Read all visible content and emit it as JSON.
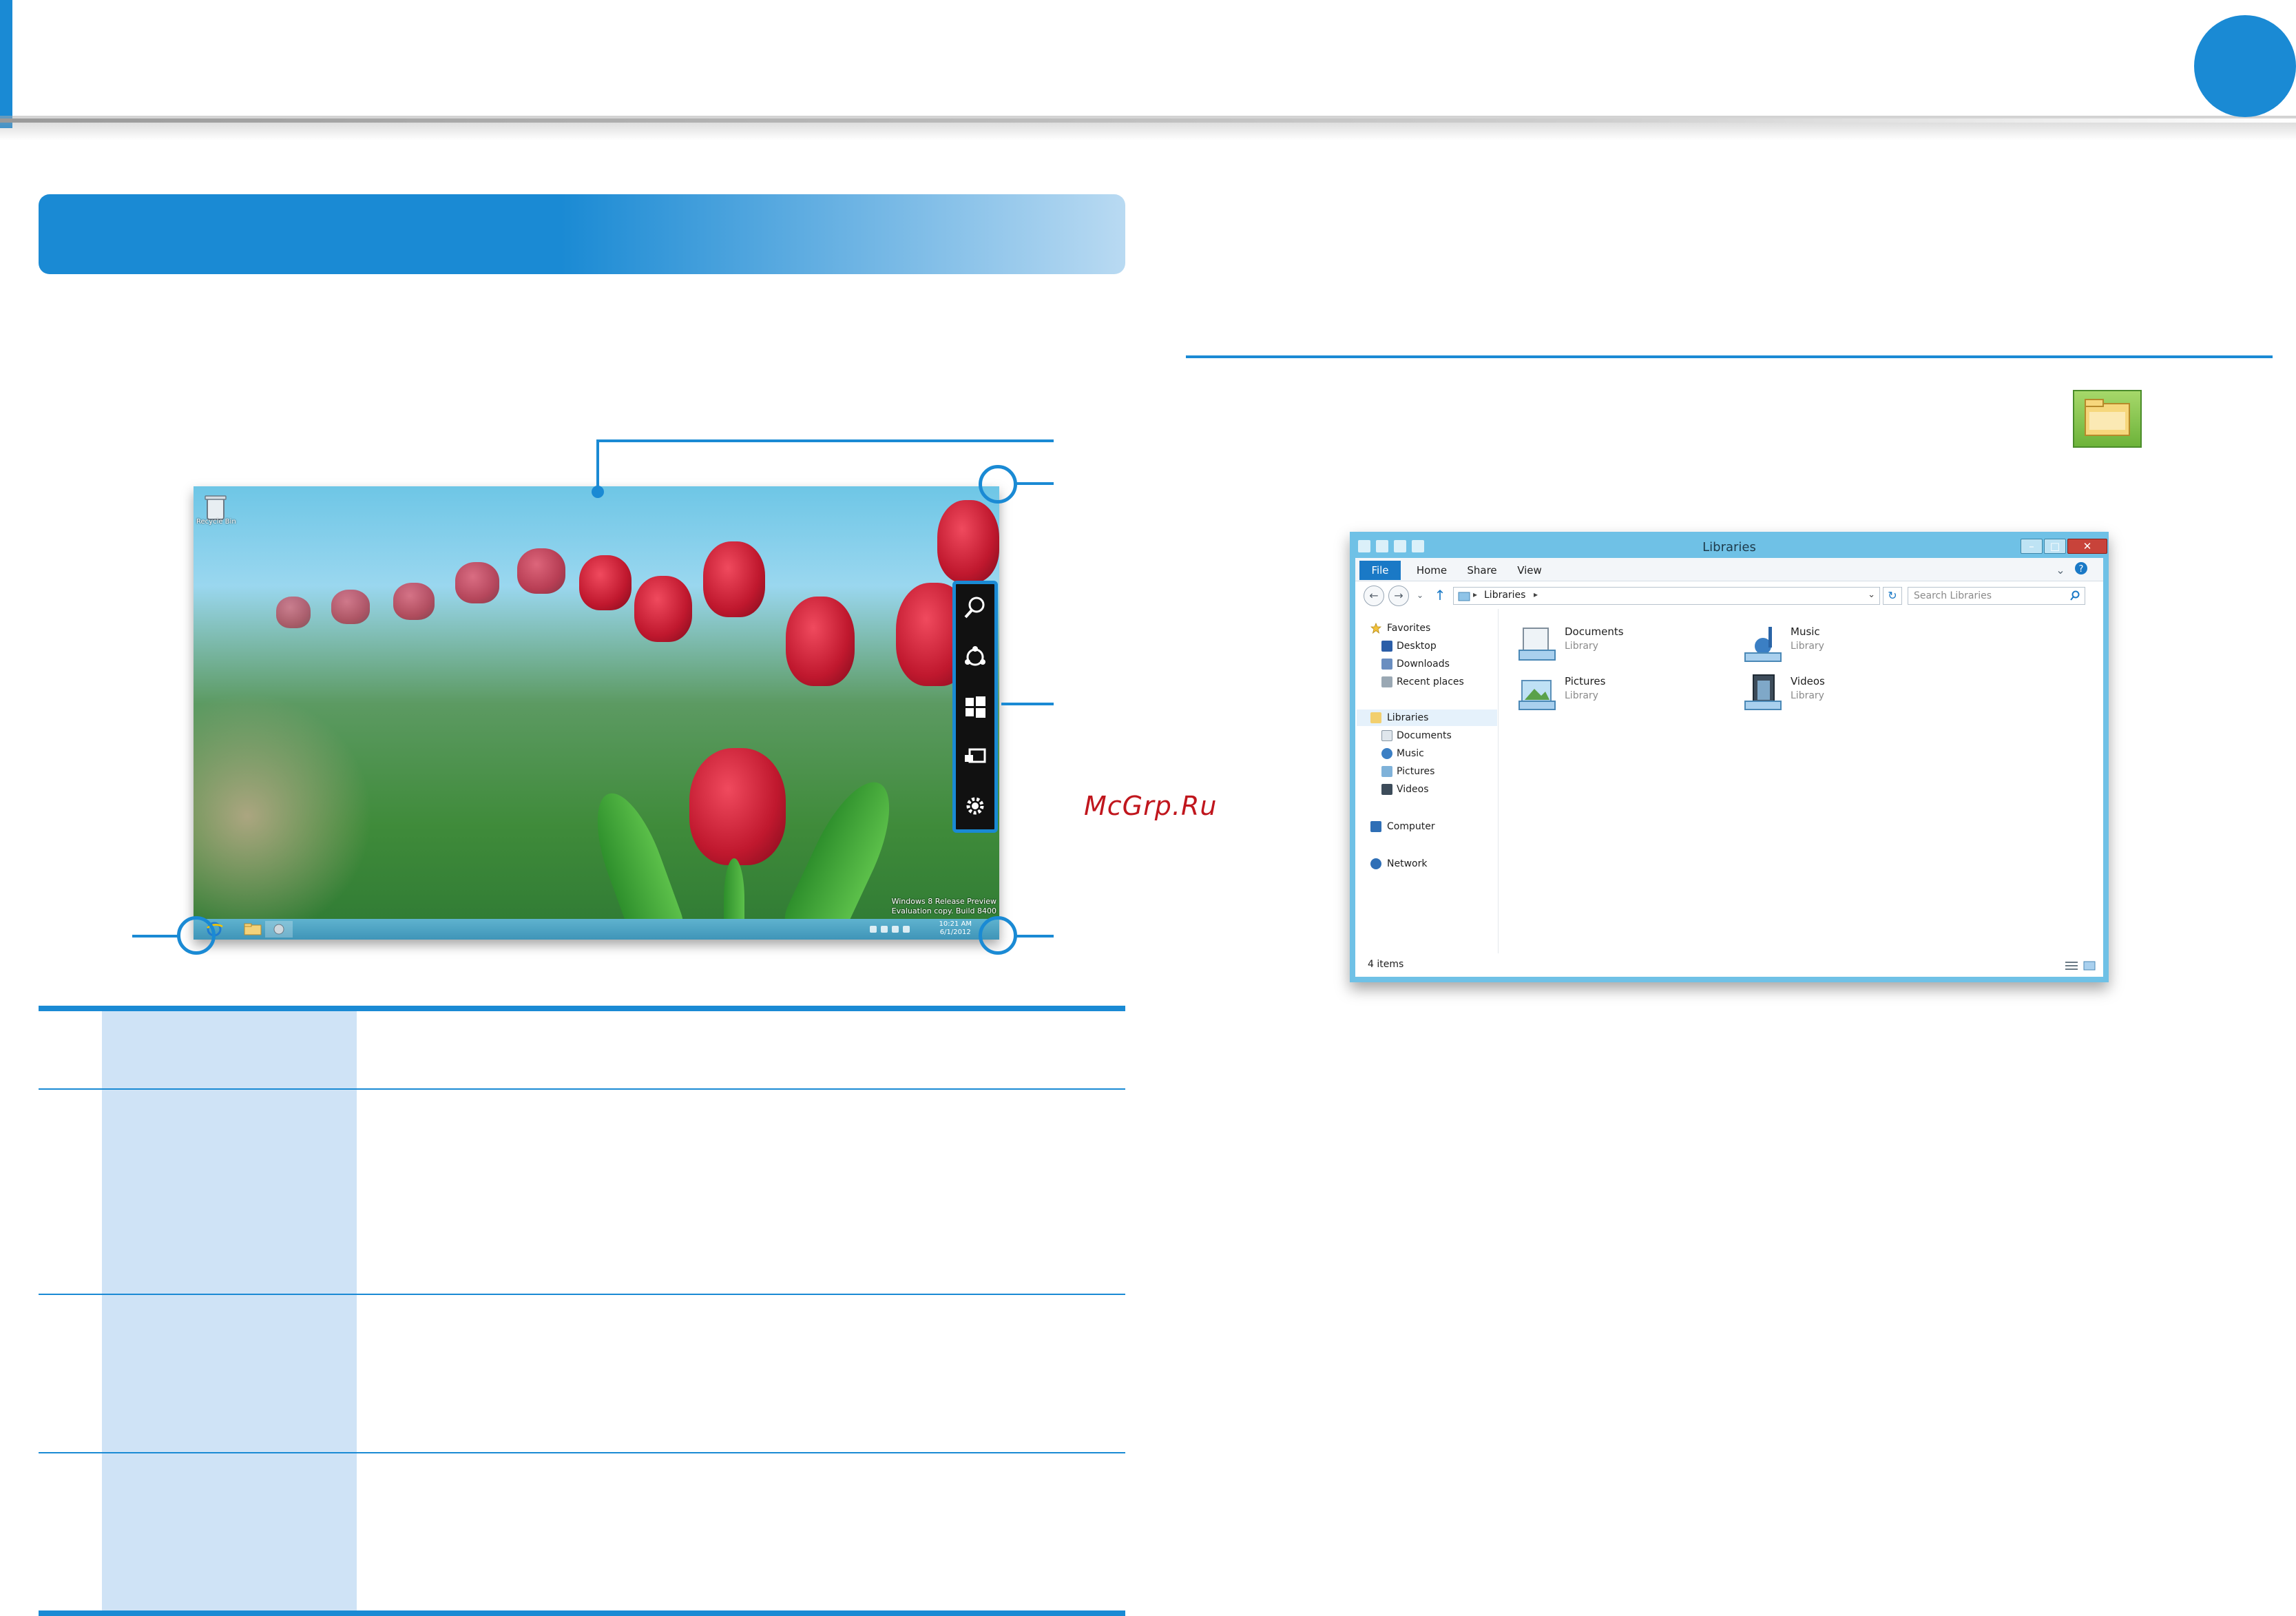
{
  "colors": {
    "accent": "#1a8ad4",
    "table_column": "#cfe3f6",
    "watermark_text": "#c0161d"
  },
  "desktop": {
    "recycle_bin_label": "Recycle Bin",
    "watermark_lines": [
      "Windows 8 Release Preview",
      "Evaluation copy. Build 8400"
    ],
    "clock": {
      "time": "10:21 AM",
      "date": "6/1/2012"
    },
    "charms": [
      "search-icon",
      "share-icon",
      "windows-start-icon",
      "devices-icon",
      "settings-icon"
    ],
    "taskbar_items": [
      "internet-explorer-icon",
      "file-explorer-icon",
      "control-panel-icon"
    ]
  },
  "site_watermark": "McGrp.Ru",
  "explorer": {
    "title": "Libraries",
    "tabs": [
      "File",
      "Home",
      "Share",
      "View"
    ],
    "address": "Libraries",
    "search_placeholder": "Search Libraries",
    "nav": {
      "favorites": "Favorites",
      "favorites_items": [
        "Desktop",
        "Downloads",
        "Recent places"
      ],
      "libraries": "Libraries",
      "libraries_items": [
        "Documents",
        "Music",
        "Pictures",
        "Videos"
      ],
      "computer": "Computer",
      "network": "Network"
    },
    "items": [
      {
        "name": "Documents",
        "type": "Library"
      },
      {
        "name": "Music",
        "type": "Library"
      },
      {
        "name": "Pictures",
        "type": "Library"
      },
      {
        "name": "Videos",
        "type": "Library"
      }
    ],
    "status": "4 items"
  }
}
